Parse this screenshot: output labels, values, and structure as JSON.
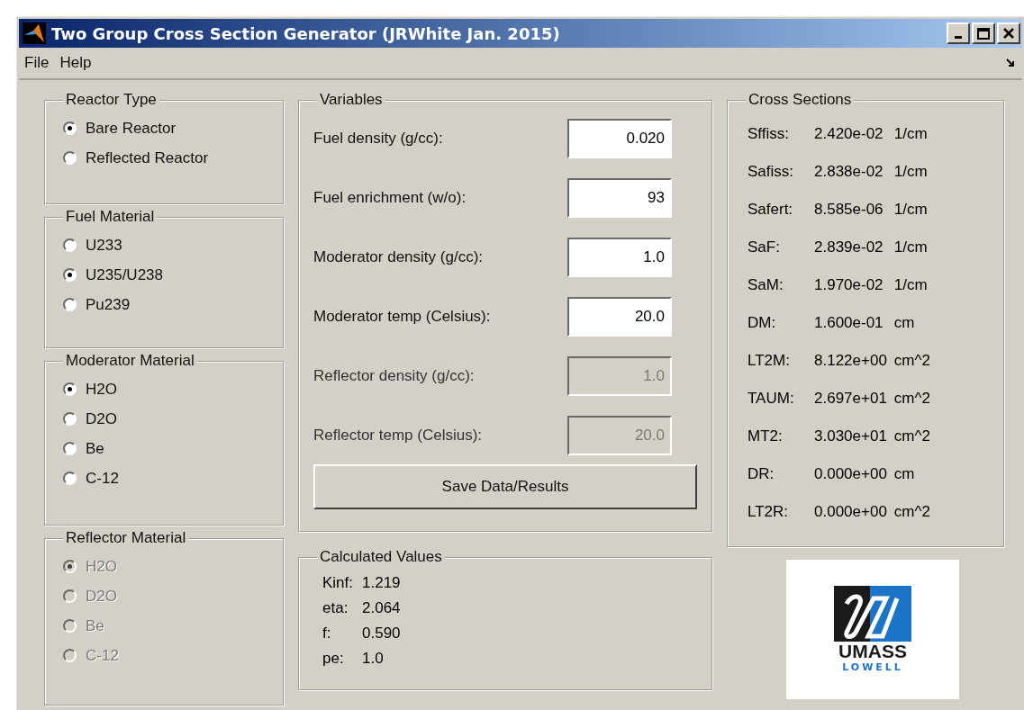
{
  "window": {
    "title": "Two Group Cross Section Generator (JRWhite Jan. 2015)"
  },
  "menu": [
    {
      "label": "File"
    },
    {
      "label": "Help"
    }
  ],
  "radio_groups": [
    {
      "title": "Reactor Type",
      "disabled": false,
      "options": [
        {
          "label": "Bare Reactor",
          "selected": true
        },
        {
          "label": "Reflected Reactor",
          "selected": false
        }
      ]
    },
    {
      "title": "Fuel Material",
      "disabled": false,
      "options": [
        {
          "label": "U233",
          "selected": false
        },
        {
          "label": "U235/U238",
          "selected": true
        },
        {
          "label": "Pu239",
          "selected": false
        }
      ]
    },
    {
      "title": "Moderator Material",
      "disabled": false,
      "options": [
        {
          "label": "H2O",
          "selected": true
        },
        {
          "label": "D2O",
          "selected": false
        },
        {
          "label": "Be",
          "selected": false
        },
        {
          "label": "C-12",
          "selected": false
        }
      ]
    },
    {
      "title": "Reflector Material",
      "disabled": true,
      "options": [
        {
          "label": "H2O",
          "selected": true
        },
        {
          "label": "D2O",
          "selected": false
        },
        {
          "label": "Be",
          "selected": false
        },
        {
          "label": "C-12",
          "selected": false
        }
      ]
    }
  ],
  "variables": {
    "title": "Variables",
    "fields": [
      {
        "label": "Fuel density (g/cc):",
        "value": "0.020",
        "disabled": false
      },
      {
        "label": "Fuel enrichment (w/o):",
        "value": "93",
        "disabled": false
      },
      {
        "label": "Moderator density (g/cc):",
        "value": "1.0",
        "disabled": false
      },
      {
        "label": "Moderator temp (Celsius):",
        "value": "20.0",
        "disabled": false
      },
      {
        "label": "Reflector density (g/cc):",
        "value": "1.0",
        "disabled": true
      },
      {
        "label": "Reflector temp (Celsius):",
        "value": "20.0",
        "disabled": true
      }
    ],
    "button": "Save Data/Results"
  },
  "calculated_values": {
    "title": "Calculated Values",
    "rows": [
      {
        "label": "Kinf:",
        "value": "1.219"
      },
      {
        "label": "eta:",
        "value": "2.064"
      },
      {
        "label": "f:",
        "value": "0.590"
      },
      {
        "label": "pe:",
        "value": "1.0"
      }
    ]
  },
  "cross_sections": {
    "title": "Cross Sections",
    "rows": [
      {
        "label": "Sffiss:",
        "value": "2.420e-02",
        "unit": "1/cm"
      },
      {
        "label": "Safiss:",
        "value": "2.838e-02",
        "unit": "1/cm"
      },
      {
        "label": "Safert:",
        "value": "8.585e-06",
        "unit": "1/cm"
      },
      {
        "label": "SaF:",
        "value": "2.839e-02",
        "unit": "1/cm"
      },
      {
        "label": "SaM:",
        "value": "1.970e-02",
        "unit": "1/cm"
      },
      {
        "label": "DM:",
        "value": "1.600e-01",
        "unit": "cm"
      },
      {
        "label": "LT2M:",
        "value": "8.122e+00",
        "unit": "cm^2"
      },
      {
        "label": "TAUM:",
        "value": "2.697e+01",
        "unit": "cm^2"
      },
      {
        "label": "MT2:",
        "value": "3.030e+01",
        "unit": "cm^2"
      },
      {
        "label": "DR:",
        "value": "0.000e+00",
        "unit": "cm"
      },
      {
        "label": "LT2R:",
        "value": "0.000e+00",
        "unit": "cm^2"
      }
    ]
  },
  "logo": {
    "lines": [
      "UMASS",
      "LOWELL"
    ]
  }
}
